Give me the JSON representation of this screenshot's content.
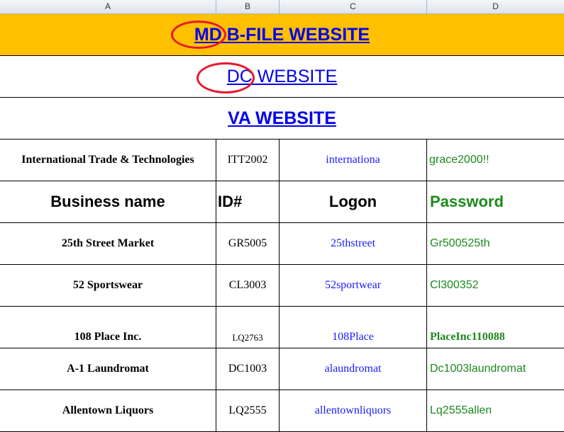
{
  "columns": [
    "A",
    "B",
    "C",
    "D"
  ],
  "banners": {
    "md": "MD B-FILE WEBSITE",
    "dc": "DC WEBSITE",
    "va": "VA WEBSITE"
  },
  "first_entry": {
    "business": "International Trade & Technologies",
    "id": "ITT2002",
    "logon": "internationa",
    "password": "grace2000!!"
  },
  "headers": {
    "business": "Business name",
    "id": "ID#",
    "logon": "Logon",
    "password": "Password"
  },
  "entries": [
    {
      "business": "25th Street Market",
      "id": "GR5005",
      "logon": "25thstreet",
      "password": "Gr500525th"
    },
    {
      "business": "52 Sportswear",
      "id": "CL3003",
      "logon": "52sportwear",
      "password": "Cl300352"
    },
    {
      "business": "108 Place Inc.",
      "id": "LQ2763",
      "logon": "108Place",
      "password": "PlaceInc110088"
    },
    {
      "business": "A-1 Laundromat",
      "id": "DC1003",
      "logon": "alaundromat",
      "password": "Dc1003laundromat"
    },
    {
      "business": "Allentown Liquors",
      "id": "LQ2555",
      "logon": "allentownliquors",
      "password": "Lq2555allen"
    }
  ],
  "colors": {
    "banner_fill": "#ffc000",
    "link": "#0000ee",
    "password_green": "#1c8a1c",
    "annotation_red": "#e8192c"
  }
}
